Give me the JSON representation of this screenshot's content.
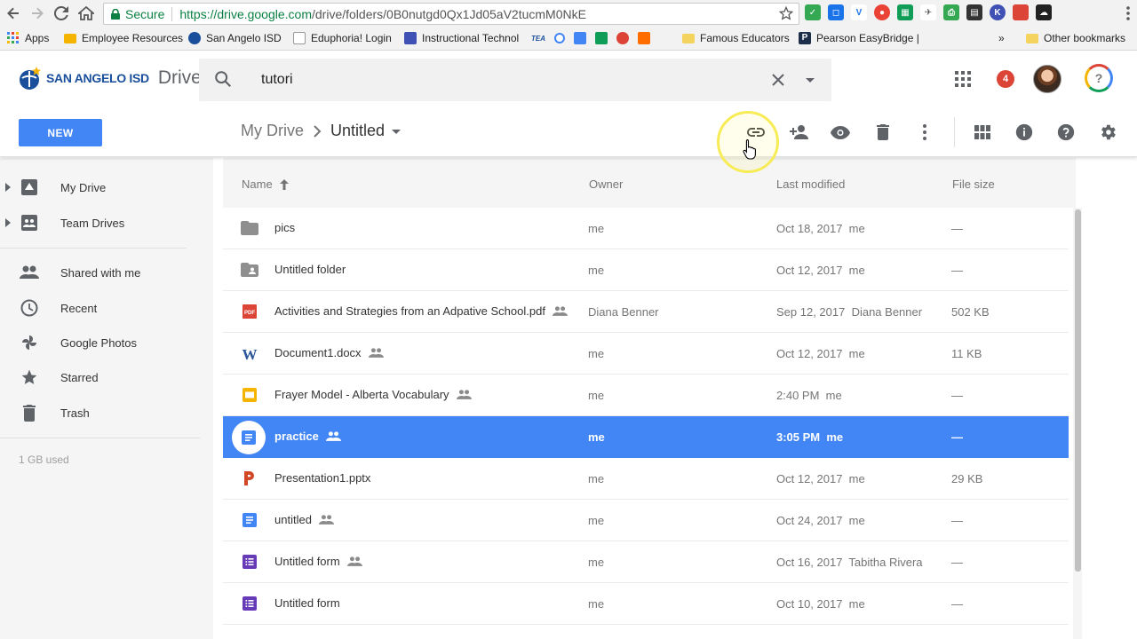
{
  "browser": {
    "secure_label": "Secure",
    "url_host": "https://drive.google.com",
    "url_path": "/drive/folders/0B0nutgd0Qx1Jd05aV2tucmM0NkE",
    "bookmarks": [
      {
        "label": "Apps",
        "color": "#4285f4"
      },
      {
        "label": "Employee Resources",
        "color": "#f4b400"
      },
      {
        "label": "San Angelo ISD",
        "color": "#1a4f9c"
      },
      {
        "label": "Eduphoria! Login",
        "color": "#9e9e9e"
      },
      {
        "label": "Instructional Technol",
        "color": "#3f51b5"
      },
      {
        "label": "Famous Educators",
        "color": "#f4d35e"
      },
      {
        "label": "Pearson EasyBridge |",
        "color": "#1c2e4a"
      }
    ],
    "other_bookmarks": "Other bookmarks",
    "overflow": "»"
  },
  "header": {
    "logo_text": "SAN ANGELO ISD",
    "product": "Drive",
    "search_value": "tutori",
    "notification_count": "4"
  },
  "toolbar": {
    "new_label": "NEW",
    "breadcrumb_root": "My Drive",
    "breadcrumb_current": "Untitled"
  },
  "sidebar": {
    "items": [
      {
        "label": "My Drive",
        "icon": "drive-icon"
      },
      {
        "label": "Team Drives",
        "icon": "team-drives-icon"
      },
      {
        "label": "Shared with me",
        "icon": "people-icon"
      },
      {
        "label": "Recent",
        "icon": "clock-icon"
      },
      {
        "label": "Google Photos",
        "icon": "photos-icon"
      },
      {
        "label": "Starred",
        "icon": "star-icon"
      },
      {
        "label": "Trash",
        "icon": "trash-icon"
      }
    ],
    "storage": "1 GB used"
  },
  "columns": {
    "name": "Name",
    "owner": "Owner",
    "modified": "Last modified",
    "size": "File size"
  },
  "files": [
    {
      "name": "pics",
      "owner": "me",
      "modified": "Oct 18, 2017  me",
      "size": "—",
      "type": "folder",
      "shared": false
    },
    {
      "name": "Untitled folder",
      "owner": "me",
      "modified": "Oct 12, 2017  me",
      "size": "—",
      "type": "shared-folder",
      "shared": false
    },
    {
      "name": "Activities and Strategies from an Adpative School.pdf",
      "owner": "Diana Benner",
      "modified": "Sep 12, 2017  Diana Benner",
      "size": "502 KB",
      "type": "pdf",
      "shared": true
    },
    {
      "name": "Document1.docx",
      "owner": "me",
      "modified": "Oct 12, 2017  me",
      "size": "11 KB",
      "type": "word",
      "shared": true
    },
    {
      "name": "Frayer Model - Alberta Vocabulary",
      "owner": "me",
      "modified": "2:40 PM  me",
      "size": "—",
      "type": "slides",
      "shared": true
    },
    {
      "name": "practice",
      "owner": "me",
      "modified": "3:05 PM  me",
      "size": "—",
      "type": "doc",
      "shared": true,
      "selected": true
    },
    {
      "name": "Presentation1.pptx",
      "owner": "me",
      "modified": "Oct 12, 2017  me",
      "size": "29 KB",
      "type": "powerpoint",
      "shared": false
    },
    {
      "name": "untitled",
      "owner": "me",
      "modified": "Oct 24, 2017  me",
      "size": "—",
      "type": "doc",
      "shared": true
    },
    {
      "name": "Untitled form",
      "owner": "me",
      "modified": "Oct 16, 2017  Tabitha Rivera",
      "size": "—",
      "type": "form",
      "shared": true
    },
    {
      "name": "Untitled form",
      "owner": "me",
      "modified": "Oct 10, 2017  me",
      "size": "—",
      "type": "form",
      "shared": false
    }
  ],
  "colors": {
    "accent": "#4285f4",
    "pdf": "#db4437",
    "word": "#2b579a",
    "slides": "#f4b400",
    "powerpoint": "#d24726",
    "form": "#673ab7",
    "folder": "#8f8f8f"
  }
}
